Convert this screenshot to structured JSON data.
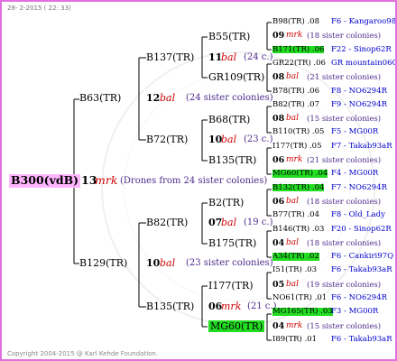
{
  "header": {
    "date": "28-  2-2015 ( 22: 33)"
  },
  "footer": {
    "copyright": "Copyright 2004-2015 @ Karl Kehde Foundation."
  },
  "root": {
    "id": "B300(vdB)",
    "year": "13",
    "mark": "mrk",
    "note": "(Drones from 24 sister colonies)"
  },
  "gen1": [
    {
      "id": "B63(TR)",
      "year": "12",
      "mark": "bal",
      "note": "(24 sister colonies)"
    },
    {
      "id": "B129(TR)",
      "year": "10",
      "mark": "bal",
      "note": "(23 sister colonies)"
    }
  ],
  "gen2": [
    {
      "id": "B137(TR)",
      "year": "11",
      "mark": "bal",
      "note": "(24 c.)"
    },
    {
      "id": "B72(TR)",
      "year": "10",
      "mark": "bal",
      "note": "(23 c.)"
    },
    {
      "id": "B82(TR)",
      "year": "07",
      "mark": "bal",
      "note": "(19 c.)"
    },
    {
      "id": "B135(TR)",
      "year": "06",
      "mark": "mrk",
      "note": "(21 c.)"
    }
  ],
  "gen3": [
    {
      "id": "B55(TR)"
    },
    {
      "id": "GR109(TR)"
    },
    {
      "id": "B68(TR)"
    },
    {
      "id": "B135(TR)"
    },
    {
      "id": "B2(TR)"
    },
    {
      "id": "B175(TR)"
    },
    {
      "id": "I177(TR)"
    },
    {
      "id": "MG60(TR)"
    }
  ],
  "gen4": [
    {
      "id": "B98(TR) .08",
      "loc": "F6 - Kangaroo98R"
    },
    {
      "id": "09",
      "mark": "mrk",
      "note": "(18 sister colonies)"
    },
    {
      "id": "B171(TR) .06",
      "loc": "F22 - Sinop62R"
    },
    {
      "id": "GR22(TR) .06",
      "loc": "GR mountain06Q"
    },
    {
      "id": "08",
      "mark": "bal",
      "note": "(21 sister colonies)"
    },
    {
      "id": "B78(TR) .06",
      "loc": "F8 - NO6294R"
    },
    {
      "id": "B82(TR) .07",
      "loc": "F9 - NO6294R"
    },
    {
      "id": "08",
      "mark": "bal",
      "note": "(15 sister colonies)"
    },
    {
      "id": "B110(TR) .05",
      "loc": "F5 - MG00R"
    },
    {
      "id": "I177(TR) .05",
      "loc": "F7 - Takab93aR"
    },
    {
      "id": "06",
      "mark": "mrk",
      "note": "(21 sister colonies)"
    },
    {
      "id": "MG60(TR) .04",
      "loc": "F4 - MG00R"
    },
    {
      "id": "B132(TR) .04",
      "loc": "F7 - NO6294R"
    },
    {
      "id": "06",
      "mark": "bal",
      "note": "(18 sister colonies)"
    },
    {
      "id": "B77(TR) .04",
      "loc": "F8 - Old_Lady"
    },
    {
      "id": "B146(TR) .03",
      "loc": "F20 - Sinop62R"
    },
    {
      "id": "04",
      "mark": "bal",
      "note": "(18 sister colonies)"
    },
    {
      "id": "A34(TR) .02",
      "loc": "F6 - Cankiri97Q"
    },
    {
      "id": "I51(TR) .03",
      "loc": "F6 - Takab93aR"
    },
    {
      "id": "05",
      "mark": "bal",
      "note": "(19 sister colonies)"
    },
    {
      "id": "NO61(TR) .01",
      "loc": "F6 - NO6294R"
    },
    {
      "id": "MG165(TR) .03",
      "loc": "F3 - MG00R"
    },
    {
      "id": "04",
      "mark": "mrk",
      "note": "(15 sister colonies)"
    },
    {
      "id": "I89(TR) .01",
      "loc": "F6 - Takab93aR"
    }
  ],
  "colors": {
    "border": "#e070e0",
    "highlight": "#22dd22",
    "root_bg": "#ffb6ff",
    "mark": "#d00000",
    "note": "#4c2a8c",
    "loc": "#0000cc"
  }
}
